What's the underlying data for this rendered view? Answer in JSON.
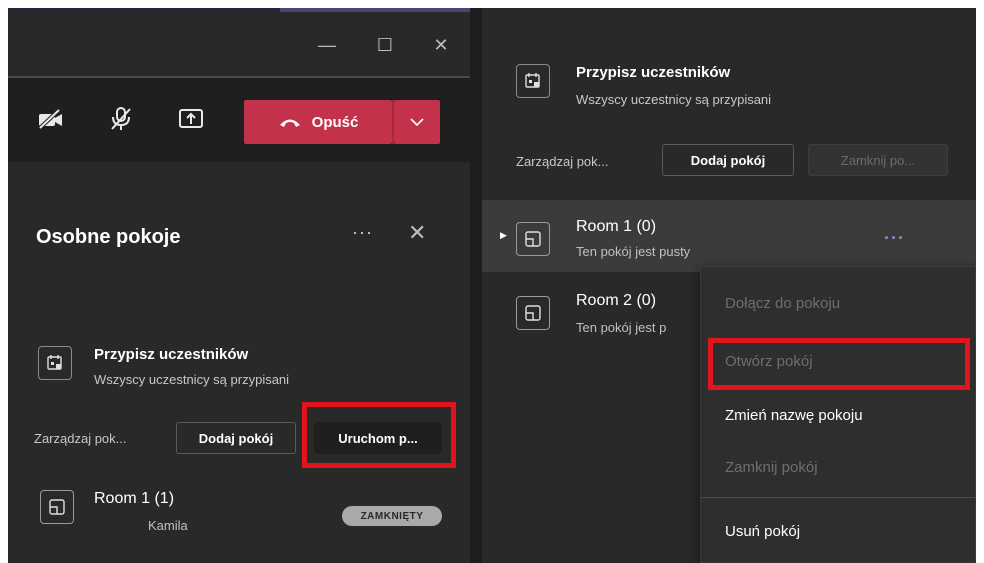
{
  "left_panel": {
    "window_controls": {
      "minimize": "—",
      "maximize": "☐",
      "close": "✕"
    },
    "toolbar": {
      "camera": "camera-off",
      "mic": "mic-off",
      "share": "share-screen",
      "leave_label": "Opuść"
    },
    "section": {
      "title": "Osobne pokoje",
      "more": "···",
      "close": "✕"
    },
    "assign": {
      "title": "Przypisz uczestników",
      "subtitle": "Wszyscy uczestnicy są przypisani"
    },
    "manage": {
      "label": "Zarządzaj pok...",
      "add_room": "Dodaj pokój",
      "start": "Uruchom p..."
    },
    "rooms": [
      {
        "name": "Room 1 (1)",
        "participant": "Kamila",
        "badge": "ZAMKNIĘTY"
      }
    ]
  },
  "right_panel": {
    "assign": {
      "title": "Przypisz uczestników",
      "subtitle": "Wszyscy uczestnicy są przypisani"
    },
    "manage": {
      "label": "Zarządzaj pok...",
      "add_room": "Dodaj pokój",
      "close_rooms": "Zamknij po..."
    },
    "rooms": [
      {
        "name": "Room 1 (0)",
        "status": "Ten pokój jest pusty"
      },
      {
        "name": "Room 2 (0)",
        "status": "Ten pokój jest p"
      }
    ],
    "row_more": "···",
    "context_menu": [
      {
        "label": "Dołącz do pokoju",
        "enabled": false
      },
      {
        "label": "Otwórz pokój",
        "enabled": false
      },
      {
        "label": "Zmień nazwę pokoju",
        "enabled": true
      },
      {
        "label": "Zamknij pokój",
        "enabled": false
      },
      {
        "label": "Usuń pokój",
        "enabled": true
      }
    ]
  },
  "colors": {
    "leave_red": "#c4314b",
    "highlight_red": "#e0141c",
    "accent_purple": "#8b8cc7",
    "panel_bg": "#292929"
  }
}
